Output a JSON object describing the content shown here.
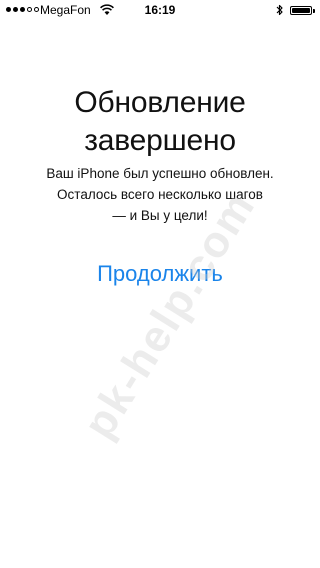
{
  "status_bar": {
    "signal_bars_filled": 3,
    "signal_bars_total": 5,
    "carrier": "MegaFon",
    "time": "16:19",
    "wifi_icon": "wifi-icon",
    "bluetooth_icon": "bluetooth-icon",
    "battery_level": 1.0
  },
  "main": {
    "title_line1": "Обновление",
    "title_line2": "завершено",
    "message_line1": "Ваш iPhone был успешно обновлен.",
    "message_line2": "Осталось всего несколько шагов",
    "message_line3": "— и Вы у цели!",
    "continue_label": "Продолжить",
    "accent_color": "#1a84ea"
  },
  "watermark": "pk-help.com"
}
